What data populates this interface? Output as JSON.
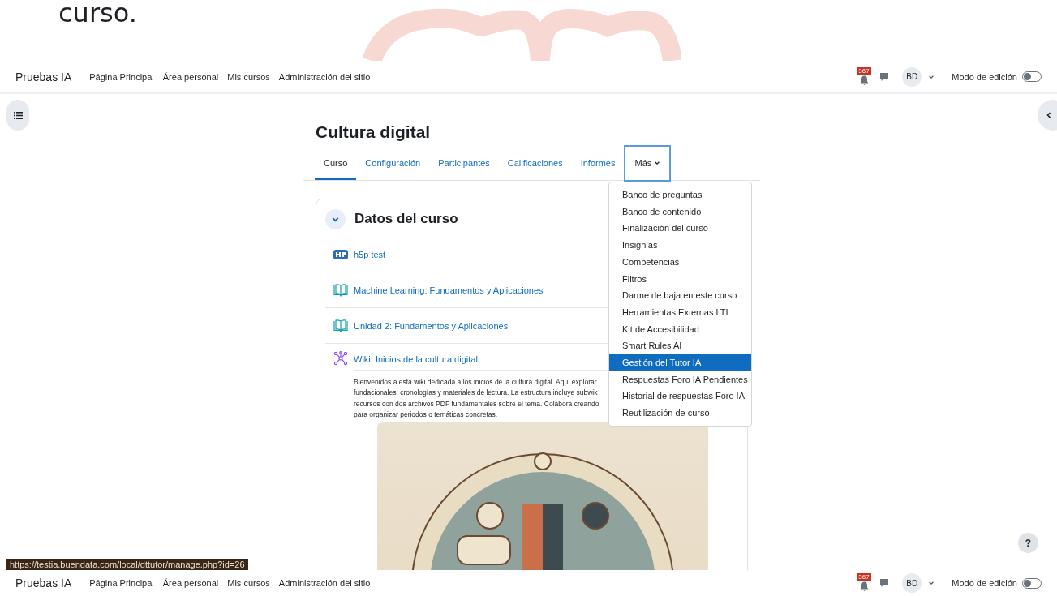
{
  "banner": {
    "text": "curso."
  },
  "navbar": {
    "brand": "Pruebas IA",
    "links": [
      "Página Principal",
      "Área personal",
      "Mis cursos",
      "Administración del sitio"
    ],
    "notification_count": "367",
    "avatar": "BD",
    "edit_mode": {
      "label": "Modo de edición",
      "on": false
    }
  },
  "course": {
    "title": "Cultura digital",
    "tabs": [
      {
        "label": "Curso",
        "selected": true,
        "kind": "link"
      },
      {
        "label": "Configuración",
        "selected": false,
        "kind": "link"
      },
      {
        "label": "Participantes",
        "selected": false,
        "kind": "link"
      },
      {
        "label": "Calificaciones",
        "selected": false,
        "kind": "link"
      },
      {
        "label": "Informes",
        "selected": false,
        "kind": "link"
      },
      {
        "label": "Más",
        "selected": false,
        "kind": "dropdown",
        "expanded": true
      }
    ],
    "menu": [
      {
        "label": "Banco de preguntas",
        "selected": false
      },
      {
        "label": "Banco de contenido",
        "selected": false
      },
      {
        "label": "Finalización del curso",
        "selected": false
      },
      {
        "label": "Insignias",
        "selected": false
      },
      {
        "label": "Competencias",
        "selected": false
      },
      {
        "label": "Filtros",
        "selected": false
      },
      {
        "label": "Darme de baja en este curso",
        "selected": false
      },
      {
        "label": "Herramientas Externas LTI",
        "selected": false
      },
      {
        "label": "Kit de Accesibilidad",
        "selected": false
      },
      {
        "label": "Smart Rules AI",
        "selected": false
      },
      {
        "label": "Gestión del Tutor IA",
        "selected": true
      },
      {
        "label": "Respuestas Foro IA Pendientes",
        "selected": false
      },
      {
        "label": "Historial de respuestas Foro IA",
        "selected": false
      },
      {
        "label": "Reutilización de curso",
        "selected": false
      }
    ],
    "section": {
      "title": "Datos del curso",
      "expanded": true,
      "activities": [
        {
          "kind": "h5p",
          "name": "h5p test"
        },
        {
          "kind": "book",
          "name": "Machine Learning: Fundamentos y Aplicaciones"
        },
        {
          "kind": "book",
          "name": "Unidad 2: Fundamentos y Aplicaciones"
        },
        {
          "kind": "wiki",
          "name": "Wiki: Inicios de la cultura digital",
          "description": [
            "Bienvenidos a esta wiki dedicada a los inicios de la cultura digital. Aquí explorar",
            "fundacionales, cronologías y materiales de lectura. La estructura incluye subwik",
            "recursos con dos archivos PDF fundamentales sobre el tema. Colabora creando",
            "para organizar periodos o temáticas concretas."
          ]
        }
      ]
    }
  },
  "status_url": "https://testia.buendata.com/local/dttutor/manage.php?id=26",
  "help": "?",
  "bottom_navbar": {
    "brand": "Pruebas IA",
    "links": [
      "Página Principal",
      "Área personal",
      "Mis cursos",
      "Administración del sitio"
    ],
    "notification_count": "367",
    "avatar": "BD",
    "edit_mode": {
      "label": "Modo de edición",
      "on": false
    }
  }
}
